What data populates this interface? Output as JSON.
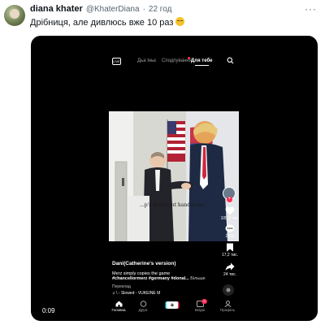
{
  "tweet": {
    "display_name": "diana khater",
    "handle": "@KhaterDiana",
    "separator": "·",
    "time": "22 год",
    "more_icon": "more-horizontal-icon",
    "text": "Дрібниця, але дивлюсь вже 10 раз",
    "emoji": "relieved-face-emoji"
  },
  "media": {
    "duration": "0:09",
    "tiktok": {
      "tabs": {
        "live_icon_label": "LIVE",
        "friends": "Дьа Іньє",
        "following": "Сподпування",
        "for_you": "Для тебе"
      },
      "video_overlay_text": "...p's dominant handshake",
      "rail": {
        "likes": "105,3 тис.",
        "comments": "2516",
        "saves": "17,2 тис.",
        "shares": "24 тис."
      },
      "author": "Dani(Catherine's version)",
      "description_line1": "Merz simply copies the game",
      "description_line2": "#chanceliormerz #germany #donal...",
      "more_label": "Більше",
      "translate_label": "Переклад",
      "sound": "♫ \\ - Slowed - VUKEINE    M",
      "nav": {
        "home": "Головна",
        "friends": "Друзі",
        "inbox": "Вхідні",
        "inbox_badge": "9",
        "profile": "Профіль"
      }
    }
  },
  "colors": {
    "accent_red": "#fe2c55",
    "accent_cyan": "#25f4ee",
    "twitter_text": "#0f1419",
    "twitter_muted": "#536471"
  }
}
